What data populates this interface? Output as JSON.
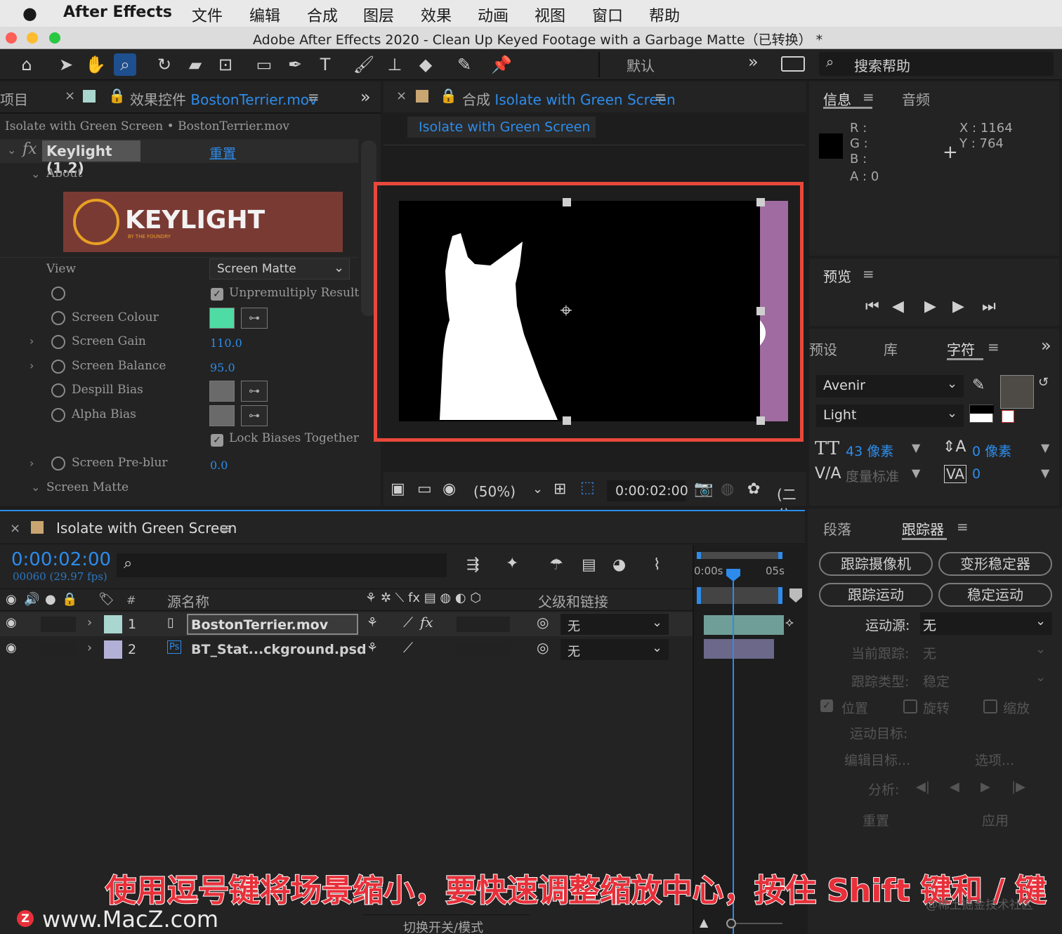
{
  "menubar": {
    "apple": "",
    "app": "After Effects",
    "items": [
      "文件",
      "编辑",
      "合成",
      "图层",
      "效果",
      "动画",
      "视图",
      "窗口",
      "帮助"
    ]
  },
  "window": {
    "title": "Adobe After Effects 2020 - Clean Up Keyed Footage with a Garbage Matte（已转换） *"
  },
  "toolbar": {
    "workspace": "默认",
    "search_help": "搜索帮助",
    "more": "»"
  },
  "effects_panel": {
    "left_tab": "项目",
    "tab_title_prefix": "效果控件",
    "tab_title_file": "BostonTerrier.mov",
    "breadcrumb": "Isolate with Green Screen • BostonTerrier.mov",
    "effect_name": "Keylight (1.2)",
    "reset": "重置",
    "about": "About",
    "logo_text": "KEYLIGHT",
    "logo_sub": "BY THE FOUNDRY",
    "view_label": "View",
    "view_value": "Screen Matte",
    "unpremultiply": "Unpremultiply Result",
    "screen_colour": "Screen Colour",
    "screen_gain": "Screen Gain",
    "screen_gain_value": "110.0",
    "screen_balance": "Screen Balance",
    "screen_balance_value": "95.0",
    "despill_bias": "Despill Bias",
    "alpha_bias": "Alpha Bias",
    "lock_biases": "Lock Biases Together",
    "screen_preblur": "Screen Pre-blur",
    "screen_preblur_value": "0.0",
    "screen_matte": "Screen Matte",
    "screen_colour_hex": "#4fdba4"
  },
  "comp_panel": {
    "tab_prefix": "合成",
    "tab_name": "Isolate with Green Screen",
    "chip": "Isolate with Green Screen",
    "zoom": "(50%)",
    "timecode": "0:00:02:00",
    "resolution": "(二分"
  },
  "info_panel": {
    "tab_info": "信息",
    "tab_audio": "音频",
    "r": "R :",
    "g": "G :",
    "b": "B :",
    "a": "A :  0",
    "x": "X : 1164",
    "y": "Y :  764"
  },
  "preview_panel": {
    "title": "预览"
  },
  "char_panel": {
    "tab_presets": "预设",
    "tab_library": "库",
    "tab_char": "字符",
    "font": "Avenir",
    "weight": "Light",
    "size": "43 像素",
    "leading": "0 像素",
    "kerning": "度量标准",
    "tracking": "0"
  },
  "timeline": {
    "tab": "Isolate with Green Screen",
    "timecode": "0:00:02:00",
    "frames": "00060 (29.97 fps)",
    "col_source": "源名称",
    "col_parent": "父级和链接",
    "col_num": "#",
    "ruler_start": "0:00s",
    "ruler_end": "05s",
    "layers": [
      {
        "num": "1",
        "name": "BostonTerrier.mov",
        "parent": "无",
        "color": "#a9d6cf"
      },
      {
        "num": "2",
        "name": "BT_Stat...ckground.psd",
        "parent": "无",
        "color": "#b3b0d8"
      }
    ],
    "toggle_modes": "切换开关/模式"
  },
  "tracker_panel": {
    "tab_paragraph": "段落",
    "tab_tracker": "跟踪器",
    "track_camera": "跟踪摄像机",
    "warp_stabilizer": "变形稳定器",
    "track_motion": "跟踪运动",
    "stabilize_motion": "稳定运动",
    "motion_source_label": "运动源:",
    "motion_source_value": "无",
    "current_track_label": "当前跟踪:",
    "current_track_value": "无",
    "track_type_label": "跟踪类型:",
    "track_type_value": "稳定",
    "position": "位置",
    "rotation": "旋转",
    "scale": "缩放",
    "motion_target": "运动目标:",
    "edit_target": "编辑目标...",
    "options": "选项...",
    "analyze": "分析:",
    "reset": "重置",
    "apply": "应用"
  },
  "caption": "使用逗号键将场景缩小，要快速调整缩放中心，按住 Shift 键和 / 键",
  "watermark_left": "www.MacZ.com",
  "watermark_right": "@稀土掘金技术社区",
  "colors": {
    "accent_blue": "#2d8ceb",
    "highlight_red": "#e8483c",
    "caption_red": "#e8303a"
  }
}
